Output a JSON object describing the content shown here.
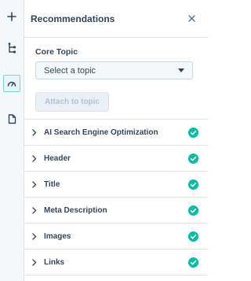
{
  "header": {
    "title": "Recommendations"
  },
  "topic": {
    "label": "Core Topic",
    "select_value": "Select a topic",
    "attach_label": "Attach to topic"
  },
  "sections": [
    {
      "label": "AI Search Engine Optimization",
      "status": "passed"
    },
    {
      "label": "Header",
      "status": "passed"
    },
    {
      "label": "Title",
      "status": "passed"
    },
    {
      "label": "Meta Description",
      "status": "passed"
    },
    {
      "label": "Images",
      "status": "passed"
    },
    {
      "label": "Links",
      "status": "passed"
    }
  ],
  "colors": {
    "success": "#00bda5",
    "accent": "#7fd1de",
    "text": "#33475b"
  },
  "rail_icons": [
    "add-icon",
    "branch-icon",
    "gauge-icon",
    "document-icon"
  ]
}
